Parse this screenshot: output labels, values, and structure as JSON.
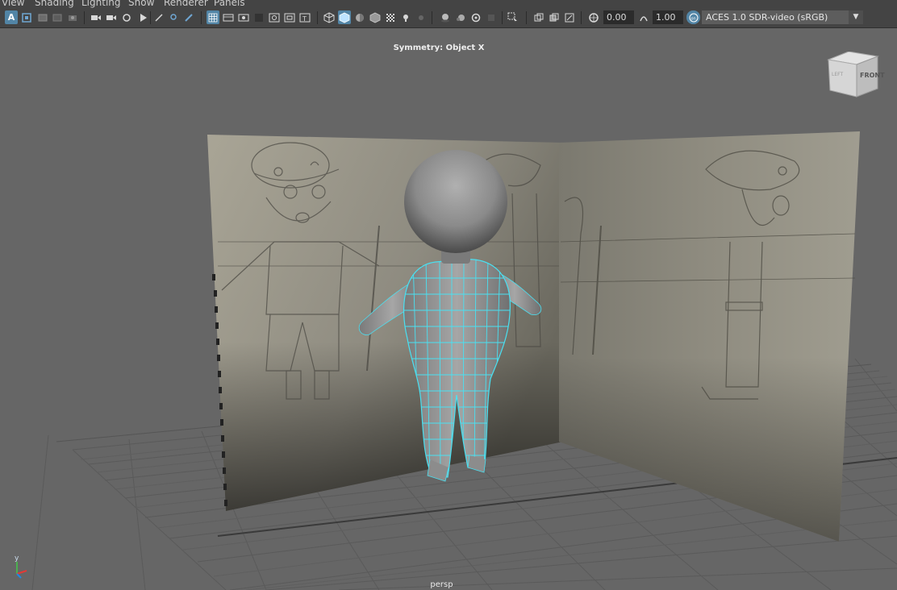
{
  "menu": {
    "view": "View",
    "shading": "Shading",
    "lighting": "Lighting",
    "show": "Show",
    "renderer": "Renderer",
    "panels": "Panels"
  },
  "toolbar": {
    "exposure_value": "0.00",
    "gamma_value": "1.00",
    "color_space": "ACES 1.0 SDR-video (sRGB)",
    "accent_color": "#5285a6",
    "icons": [
      "select-camera-icon",
      "lock-camera-icon",
      "bookmarks-icon",
      "image-plane-icon",
      "camera-attributes-icon",
      "grid-icon",
      "film-gate-icon",
      "resolution-gate-icon",
      "gate-mask-icon",
      "field-chart-icon",
      "safe-action-icon",
      "safe-title-icon",
      "wireframe-icon",
      "smooth-shade-icon",
      "flat-shade-icon",
      "bounding-box-icon",
      "textured-icon",
      "lights-icon",
      "shadows-icon",
      "ambient-occlusion-icon",
      "motion-blur-icon",
      "anti-aliasing-icon",
      "depth-of-field-icon",
      "isolate-select-icon",
      "xray-icon",
      "xray-joints-icon",
      "backface-culling-icon",
      "exposure-icon",
      "gamma-icon",
      "color-management-icon"
    ]
  },
  "viewport": {
    "status_text": "Symmetry: Object X",
    "camera_name": "persp",
    "viewcube": {
      "front_label": "FRONT",
      "side_label": "LEFT"
    },
    "axis_label_y": "y",
    "wireframe_color": "#49e1f2",
    "background_color": "#666666"
  }
}
